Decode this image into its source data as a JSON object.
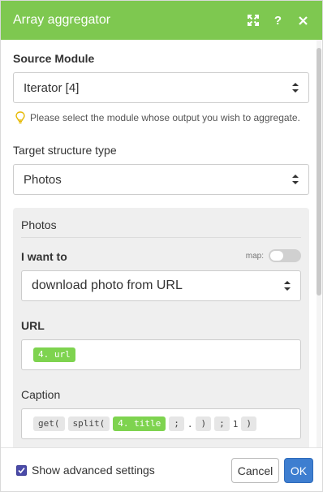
{
  "header": {
    "title": "Array aggregator",
    "icons": [
      "expand-icon",
      "help-icon",
      "close-icon"
    ]
  },
  "source_module": {
    "label": "Source Module",
    "value": "Iterator [4]",
    "hint": "Please select the module whose output you wish to aggregate."
  },
  "target_structure": {
    "label": "Target structure type",
    "value": "Photos"
  },
  "photos_group": {
    "title": "Photos",
    "i_want_to": {
      "label": "I want to",
      "map_label": "map:",
      "value": "download photo from URL"
    },
    "url": {
      "label": "URL",
      "tokens": [
        {
          "type": "var",
          "text": "4. url"
        }
      ]
    },
    "caption": {
      "label": "Caption",
      "tokens": [
        {
          "type": "fn",
          "text": "get("
        },
        {
          "type": "fn",
          "text": "split("
        },
        {
          "type": "var",
          "text": "4. title"
        },
        {
          "type": "fn",
          "text": ";"
        },
        {
          "type": "text",
          "text": "."
        },
        {
          "type": "fn",
          "text": ")"
        },
        {
          "type": "fn",
          "text": ";"
        },
        {
          "type": "text",
          "text": "1"
        },
        {
          "type": "fn",
          "text": ")"
        }
      ]
    }
  },
  "footer": {
    "show_advanced_label": "Show advanced settings",
    "show_advanced_checked": true,
    "cancel_label": "Cancel",
    "ok_label": "OK"
  },
  "colors": {
    "header_bg": "#7ec850",
    "token_green": "#7ed34f",
    "ok_button": "#3e7ed0"
  }
}
